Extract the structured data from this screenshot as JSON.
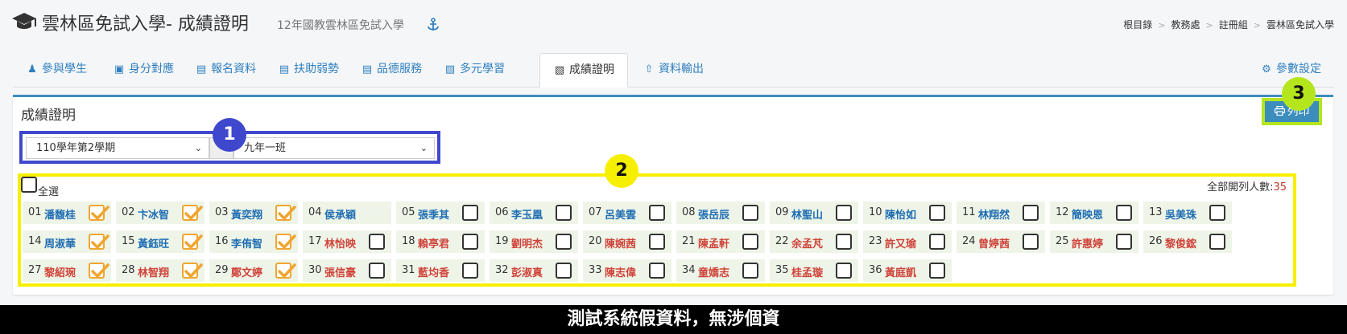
{
  "header": {
    "title": "雲林區免試入學- 成績證明",
    "subtitle": "12年國教雲林區免試入學",
    "breadcrumb": [
      "根目錄",
      "教務處",
      "註冊組",
      "雲林區免試入學"
    ]
  },
  "tabs": [
    {
      "label": "參與學生",
      "icon": "user-plus-icon"
    },
    {
      "label": "身分對應",
      "icon": "id-badge-icon"
    },
    {
      "label": "報名資料",
      "icon": "id-card-icon"
    },
    {
      "label": "扶助弱勢",
      "icon": "id-card-icon"
    },
    {
      "label": "品德服務",
      "icon": "id-card-icon"
    },
    {
      "label": "多元學習",
      "icon": "book-icon"
    },
    {
      "label": "成績證明",
      "icon": "book-icon",
      "active": true
    },
    {
      "label": "資料輸出",
      "icon": "upload-icon"
    }
  ],
  "settings_label": "參數設定",
  "panel": {
    "title": "成績證明",
    "print_label": "列印",
    "semester": "110學年第2學期",
    "class": "九年一班",
    "select_all_label": "全選",
    "total_label": "全部開列人數:",
    "total_count": "35"
  },
  "students": [
    {
      "num": "01",
      "name": "潘馥桂",
      "color": "blue",
      "checked": true
    },
    {
      "num": "02",
      "name": "卞冰智",
      "color": "blue",
      "checked": true
    },
    {
      "num": "03",
      "name": "黃奕翔",
      "color": "blue",
      "checked": true
    },
    {
      "num": "04",
      "name": "侯承穎",
      "color": "blue",
      "checked": null
    },
    {
      "num": "05",
      "name": "張季其",
      "color": "blue",
      "checked": false
    },
    {
      "num": "06",
      "name": "李玉凰",
      "color": "blue",
      "checked": false
    },
    {
      "num": "07",
      "name": "呂美雲",
      "color": "blue",
      "checked": false
    },
    {
      "num": "08",
      "name": "張岳辰",
      "color": "blue",
      "checked": false
    },
    {
      "num": "09",
      "name": "林聖山",
      "color": "blue",
      "checked": false
    },
    {
      "num": "10",
      "name": "陳怡如",
      "color": "blue",
      "checked": false
    },
    {
      "num": "11",
      "name": "林翔然",
      "color": "blue",
      "checked": false
    },
    {
      "num": "12",
      "name": "簡映恩",
      "color": "blue",
      "checked": false
    },
    {
      "num": "13",
      "name": "吳美珠",
      "color": "blue",
      "checked": false
    },
    {
      "num": "14",
      "name": "周淑華",
      "color": "blue",
      "checked": true
    },
    {
      "num": "15",
      "name": "黃鈺旺",
      "color": "blue",
      "checked": true
    },
    {
      "num": "16",
      "name": "李侑智",
      "color": "blue",
      "checked": true
    },
    {
      "num": "17",
      "name": "林怡映",
      "color": "red",
      "checked": false
    },
    {
      "num": "18",
      "name": "賴亭君",
      "color": "red",
      "checked": false
    },
    {
      "num": "19",
      "name": "劉明杰",
      "color": "red",
      "checked": false
    },
    {
      "num": "20",
      "name": "陳婉茜",
      "color": "red",
      "checked": false
    },
    {
      "num": "21",
      "name": "陳孟軒",
      "color": "red",
      "checked": false
    },
    {
      "num": "22",
      "name": "余孟芃",
      "color": "red",
      "checked": false
    },
    {
      "num": "23",
      "name": "許又瑜",
      "color": "red",
      "checked": false
    },
    {
      "num": "24",
      "name": "曾婷茜",
      "color": "red",
      "checked": false
    },
    {
      "num": "25",
      "name": "許惠婷",
      "color": "red",
      "checked": false
    },
    {
      "num": "26",
      "name": "黎俊鋐",
      "color": "red",
      "checked": false
    },
    {
      "num": "27",
      "name": "黎紹琬",
      "color": "red",
      "checked": true
    },
    {
      "num": "28",
      "name": "林智翔",
      "color": "red",
      "checked": true
    },
    {
      "num": "29",
      "name": "鄭文婷",
      "color": "red",
      "checked": true
    },
    {
      "num": "30",
      "name": "張信豪",
      "color": "red",
      "checked": false
    },
    {
      "num": "31",
      "name": "藍均香",
      "color": "red",
      "checked": false
    },
    {
      "num": "32",
      "name": "彭淑真",
      "color": "red",
      "checked": false
    },
    {
      "num": "33",
      "name": "陳志偉",
      "color": "red",
      "checked": false
    },
    {
      "num": "34",
      "name": "童嬌志",
      "color": "red",
      "checked": false
    },
    {
      "num": "35",
      "name": "桂孟璇",
      "color": "red",
      "checked": false
    },
    {
      "num": "36",
      "name": "黃庭凱",
      "color": "red",
      "checked": false
    }
  ],
  "callouts": [
    "1",
    "2",
    "3"
  ],
  "footer": "測試系統假資料，無涉個資"
}
